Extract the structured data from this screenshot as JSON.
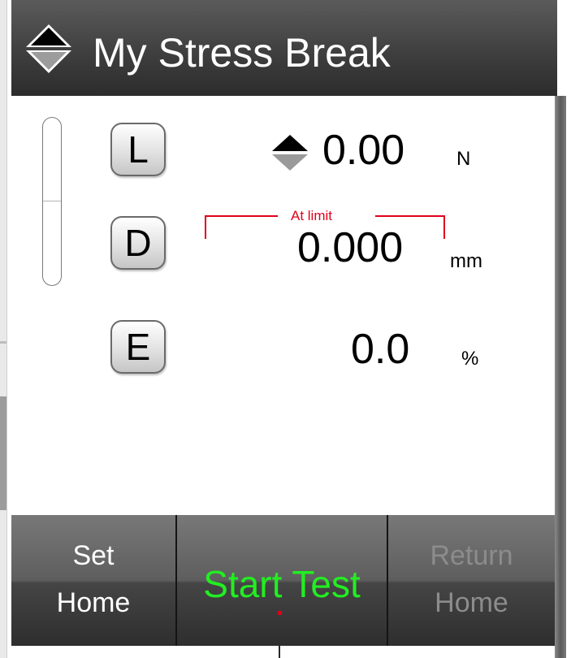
{
  "window": {
    "title": "My Stress Break"
  },
  "readouts": {
    "load": {
      "button_label": "L",
      "value": "0.00",
      "unit": "N"
    },
    "displacement": {
      "button_label": "D",
      "value": "0.000",
      "unit": "mm",
      "limit_label": "At limit"
    },
    "extension": {
      "button_label": "E",
      "value": "0.0",
      "unit": "%"
    }
  },
  "toolbar": {
    "set_home": {
      "line1": "Set",
      "line2": "Home"
    },
    "start_test": {
      "label": "Start Test"
    },
    "return_home": {
      "line1": "Return",
      "line2": "Home",
      "enabled": false
    }
  },
  "colors": {
    "title_bg": "#3f3f3f",
    "start_test_text": "#22ee22",
    "limit_indicator": "#e0001a",
    "disabled_text": "#8c8c8c"
  },
  "icons": [
    "up-down-arrows-icon",
    "load-direction-arrows-icon"
  ]
}
